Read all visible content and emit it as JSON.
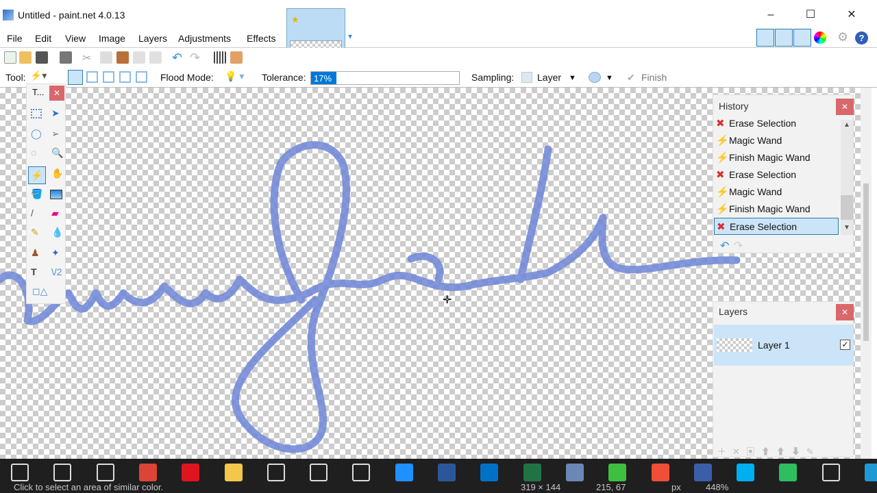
{
  "window": {
    "title": "Untitled - paint.net 4.0.13",
    "minimize": "–",
    "maximize": "☐",
    "close": "✕"
  },
  "menu": [
    "File",
    "Edit",
    "View",
    "Image",
    "Layers",
    "Adjustments",
    "Effects"
  ],
  "tool_options": {
    "tool_label": "Tool:",
    "flood_mode_label": "Flood Mode:",
    "tolerance_label": "Tolerance:",
    "tolerance_value": "17%",
    "tolerance_percent": 17,
    "sampling_label": "Sampling:",
    "sampling_value": "Layer",
    "finish_label": "Finish"
  },
  "tools_window": {
    "title": "T..."
  },
  "history": {
    "title": "History",
    "items": [
      {
        "label": "Erase Selection",
        "icon": "erase-x-icon"
      },
      {
        "label": "Magic Wand",
        "icon": "magic-wand-icon"
      },
      {
        "label": "Finish Magic Wand",
        "icon": "magic-wand-icon"
      },
      {
        "label": "Erase Selection",
        "icon": "erase-x-icon"
      },
      {
        "label": "Magic Wand",
        "icon": "magic-wand-icon"
      },
      {
        "label": "Finish Magic Wand",
        "icon": "magic-wand-icon"
      },
      {
        "label": "Erase Selection",
        "icon": "erase-x-icon",
        "selected": true
      }
    ]
  },
  "layers": {
    "title": "Layers",
    "items": [
      {
        "label": "Layer 1",
        "visible": true
      }
    ]
  },
  "status": {
    "hint": "Click to select an area of similar color.",
    "size": "319 × 144",
    "cursor": "215, 67",
    "unit": "px",
    "zoom": "448%"
  },
  "taskbar": [
    "windows",
    "cortana",
    "task-view",
    "chrome",
    "opera",
    "file-explorer",
    "store",
    "app",
    "app",
    "people",
    "word",
    "outlook",
    "excel",
    "virtualbox",
    "camtasia",
    "camtasia-recorder",
    "paint.net",
    "skype",
    "evernote",
    "app",
    "snagit"
  ],
  "colors": {
    "accent": "#0078d7",
    "selection": "#cce4f7",
    "close": "#d9686a"
  }
}
